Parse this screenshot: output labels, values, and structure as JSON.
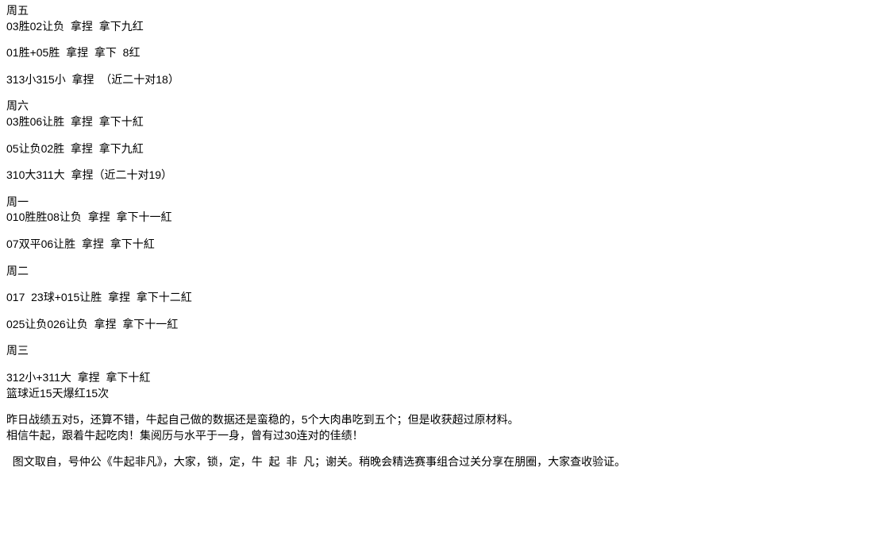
{
  "sections": [
    {
      "header": "周五",
      "lines": [
        "03胜02让负  拿捏  拿下九红",
        "01胜+05胜  拿捏  拿下  8红",
        "313小315小  拿捏  （近二十对18）"
      ]
    },
    {
      "header": "周六",
      "lines": [
        "03胜06让胜  拿捏  拿下十紅",
        "05让负02胜  拿捏  拿下九紅",
        "310大311大  拿捏（近二十对19）"
      ]
    },
    {
      "header": "周一",
      "lines": [
        "010胜胜08让负  拿捏  拿下十一紅",
        "07双平06让胜  拿捏  拿下十紅"
      ]
    },
    {
      "header": "周二",
      "lines": [
        "017  23球+015让胜  拿捏  拿下十二紅",
        "025让负026让负  拿捏  拿下十一紅"
      ]
    },
    {
      "header": "周三",
      "lines": [
        "312小+311大  拿捏  拿下十紅"
      ]
    }
  ],
  "footer": {
    "streak_line": "篮球近15天爆红15次",
    "summary_line1": "昨日战绩五对5，还算不错，牛起自己做的数据还是蛮稳的，5个大肉串吃到五个；但是收获超过原材料。",
    "summary_line2": "相信牛起，跟着牛起吃肉！集阅历与水平于一身，曾有过30连对的佳绩！",
    "credit_line": "  图文取自，号仲公《牛起非凡》，大家，锁，定，牛  起  非  凡；谢关。稍晚会精选赛事组合过关分享在朋圈，大家查收验证。"
  }
}
